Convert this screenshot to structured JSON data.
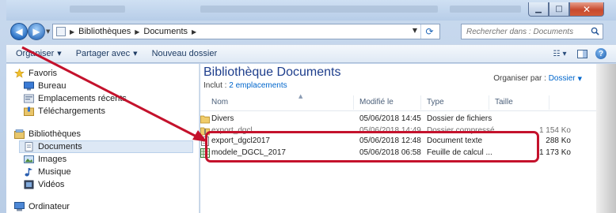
{
  "address": {
    "crumbs": [
      "Bibliothèques",
      "Documents"
    ],
    "search_placeholder": "Rechercher dans : Documents"
  },
  "toolbar": {
    "organize": "Organiser",
    "share": "Partager avec",
    "new_folder": "Nouveau dossier"
  },
  "nav": {
    "favorites": "Favoris",
    "desktop": "Bureau",
    "recent": "Emplacements récents",
    "downloads": "Téléchargements",
    "libraries": "Bibliothèques",
    "documents": "Documents",
    "images": "Images",
    "music": "Musique",
    "videos": "Vidéos",
    "computer": "Ordinateur"
  },
  "library": {
    "title": "Bibliothèque Documents",
    "includes_prefix": "Inclut :",
    "includes_link": "2 emplacements",
    "arrange_label": "Organiser par :",
    "arrange_value": "Dossier"
  },
  "columns": {
    "name": "Nom",
    "date": "Modifié le",
    "type": "Type",
    "size": "Taille"
  },
  "files": [
    {
      "name": "Divers",
      "date": "05/06/2018 14:45",
      "type": "Dossier de fichiers",
      "size": "",
      "icon": "folder-icon"
    },
    {
      "name": "export_dgcl",
      "date": "05/06/2018 14:49",
      "type": "Dossier compressé",
      "size": "1 154 Ko",
      "icon": "zip-folder-icon"
    },
    {
      "name": "export_dgcl2017",
      "date": "05/06/2018 12:48",
      "type": "Document texte",
      "size": "288 Ko",
      "icon": "text-file-icon"
    },
    {
      "name": "modele_DGCL_2017",
      "date": "05/06/2018 06:58",
      "type": "Feuille de calcul ...",
      "size": "1 173 Ko",
      "icon": "spreadsheet-icon"
    }
  ],
  "colors": {
    "annotation": "#c4122c",
    "title_blue": "#1e3e8c",
    "link_blue": "#0066cc"
  }
}
